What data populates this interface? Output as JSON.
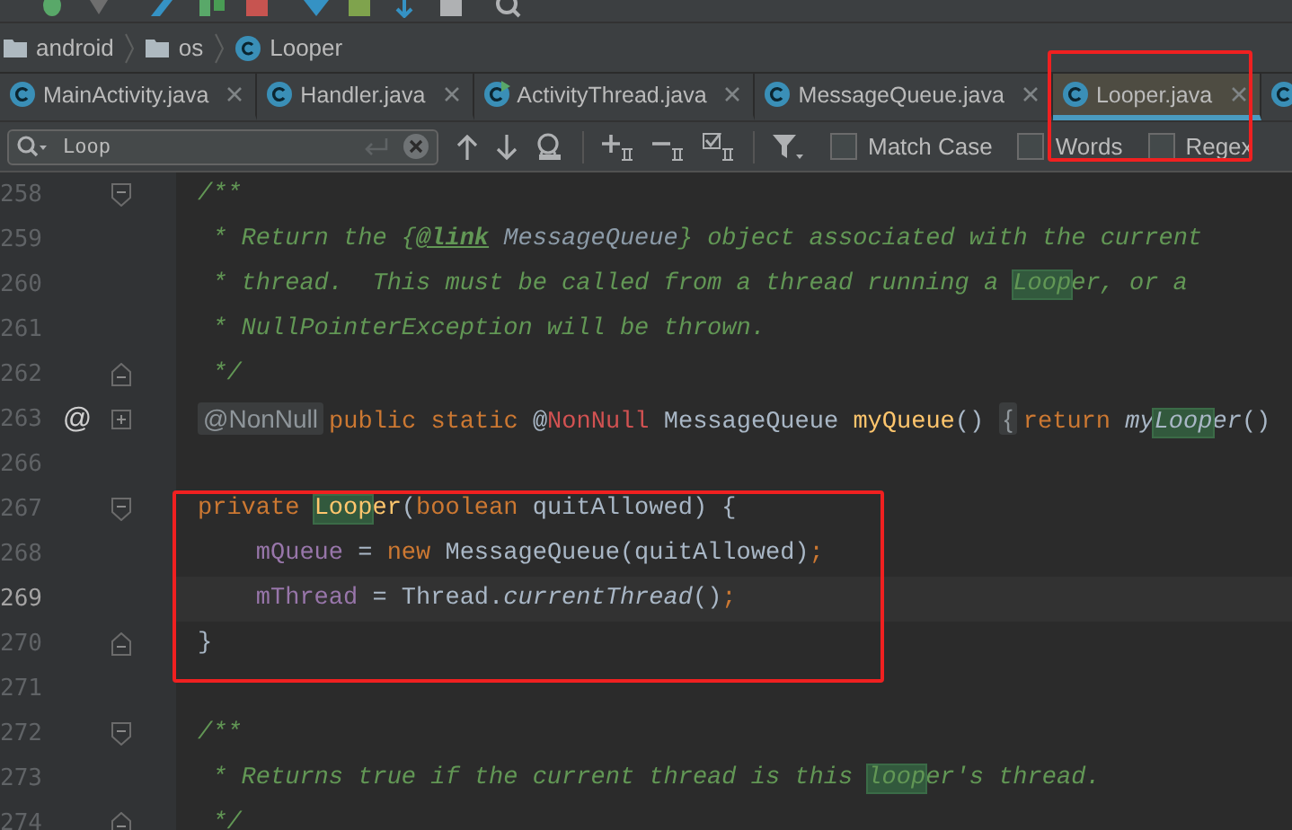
{
  "breadcrumb": [
    {
      "label": "android",
      "kind": "folder"
    },
    {
      "label": "os",
      "kind": "folder"
    },
    {
      "label": "Looper",
      "kind": "class"
    }
  ],
  "tabs": [
    {
      "label": "MainActivity.java",
      "selected": false,
      "kind": "class"
    },
    {
      "label": "Handler.java",
      "selected": false,
      "kind": "class"
    },
    {
      "label": "ActivityThread.java",
      "selected": false,
      "kind": "runnable"
    },
    {
      "label": "MessageQueue.java",
      "selected": false,
      "kind": "class"
    },
    {
      "label": "Looper.java",
      "selected": true,
      "kind": "class"
    },
    {
      "selected": false,
      "kind": "class"
    }
  ],
  "find_bar": {
    "query": "Loop",
    "options": [
      {
        "label": "Match Case",
        "checked": false
      },
      {
        "label": "Words",
        "checked": false
      },
      {
        "label": "Regex",
        "checked": false
      }
    ]
  },
  "lines": [
    {
      "number": "258",
      "current": false,
      "fold": {
        "kind": "start"
      },
      "segments": [
        {
          "text": "/**",
          "kind": "comment",
          "highlighted": false
        }
      ]
    },
    {
      "number": "259",
      "current": false,
      "segments": [
        {
          "text": " * Return the {",
          "kind": "comment",
          "highlighted": false
        },
        {
          "text": "@link",
          "kind": "comment-tag",
          "highlighted": false
        },
        {
          "text": " MessageQueue",
          "kind": "comment-ref",
          "highlighted": false
        },
        {
          "text": "} object associated with the current",
          "kind": "comment",
          "highlighted": false
        }
      ]
    },
    {
      "number": "260",
      "current": false,
      "segments": [
        {
          "text": " * thread.  This must be called from a thread running a ",
          "kind": "comment",
          "highlighted": false
        },
        {
          "text": "Loop",
          "kind": "comment",
          "highlighted": true
        },
        {
          "text": "er, or a",
          "kind": "comment",
          "highlighted": false
        }
      ]
    },
    {
      "number": "261",
      "current": false,
      "segments": [
        {
          "text": " * NullPointerException will be thrown.",
          "kind": "comment",
          "highlighted": false
        }
      ]
    },
    {
      "number": "262",
      "current": false,
      "fold": {
        "kind": "end"
      },
      "segments": [
        {
          "text": " */",
          "kind": "comment",
          "highlighted": false
        }
      ]
    },
    {
      "number": "263",
      "current": false,
      "fold": {
        "kind": "collapsed"
      },
      "marker": "@",
      "segments": [
        {
          "text": "@NonNull",
          "kind": "folded",
          "highlighted": false
        },
        {
          "text": "public static ",
          "kind": "keyword",
          "highlighted": false
        },
        {
          "text": "@",
          "kind": "plain",
          "highlighted": false
        },
        {
          "text": "NonNull",
          "kind": "annotation",
          "highlighted": false
        },
        {
          "text": " MessageQueue ",
          "kind": "plain",
          "highlighted": false
        },
        {
          "text": "myQueue",
          "kind": "method",
          "highlighted": false
        },
        {
          "text": "() ",
          "kind": "plain",
          "highlighted": false
        },
        {
          "text": "{",
          "kind": "folded",
          "highlighted": false
        },
        {
          "text": "return ",
          "kind": "keyword",
          "highlighted": false
        },
        {
          "text": "my",
          "kind": "static-call",
          "highlighted": false
        },
        {
          "text": "Loop",
          "kind": "static-call",
          "highlighted": true
        },
        {
          "text": "er",
          "kind": "static-call",
          "highlighted": false
        },
        {
          "text": "()",
          "kind": "plain",
          "highlighted": false
        }
      ]
    },
    {
      "number": "266",
      "current": false
    },
    {
      "number": "267",
      "current": false,
      "fold": {
        "kind": "start"
      },
      "segments": [
        {
          "text": "private ",
          "kind": "keyword",
          "highlighted": false
        },
        {
          "text": "Loop",
          "kind": "method",
          "highlighted": true
        },
        {
          "text": "er",
          "kind": "method",
          "highlighted": false
        },
        {
          "text": "(",
          "kind": "plain",
          "highlighted": false
        },
        {
          "text": "boolean ",
          "kind": "keyword",
          "highlighted": false
        },
        {
          "text": "quitAllowed) {",
          "kind": "plain",
          "highlighted": false
        }
      ]
    },
    {
      "number": "268",
      "current": false,
      "segments": [
        {
          "text": "    mQueue",
          "kind": "field",
          "highlighted": false
        },
        {
          "text": " = ",
          "kind": "plain",
          "highlighted": false
        },
        {
          "text": "new ",
          "kind": "keyword",
          "highlighted": false
        },
        {
          "text": "MessageQueue(quitAllowed)",
          "kind": "plain",
          "highlighted": false
        },
        {
          "text": ";",
          "kind": "keyword",
          "highlighted": false
        }
      ]
    },
    {
      "number": "269",
      "current": true,
      "segments": [
        {
          "text": "    mThread",
          "kind": "field",
          "highlighted": false
        },
        {
          "text": " = Thread.",
          "kind": "plain",
          "highlighted": false
        },
        {
          "text": "currentThread",
          "kind": "static-call",
          "highlighted": false
        },
        {
          "text": "()",
          "kind": "plain",
          "highlighted": false
        },
        {
          "text": ";",
          "kind": "keyword",
          "highlighted": false
        }
      ]
    },
    {
      "number": "270",
      "current": false,
      "fold": {
        "kind": "end"
      },
      "segments": [
        {
          "text": "}",
          "kind": "plain",
          "highlighted": false
        }
      ]
    },
    {
      "number": "271",
      "current": false
    },
    {
      "number": "272",
      "current": false,
      "fold": {
        "kind": "start"
      },
      "segments": [
        {
          "text": "/**",
          "kind": "comment",
          "highlighted": false
        }
      ]
    },
    {
      "number": "273",
      "current": false,
      "segments": [
        {
          "text": " * Returns true if the current thread is this ",
          "kind": "comment",
          "highlighted": false
        },
        {
          "text": "loop",
          "kind": "comment",
          "highlighted": true
        },
        {
          "text": "er's thread.",
          "kind": "comment",
          "highlighted": false
        }
      ]
    },
    {
      "number": "274",
      "current": false,
      "fold": {
        "kind": "end"
      },
      "segments": [
        {
          "text": " */",
          "kind": "comment",
          "highlighted": false
        }
      ]
    }
  ]
}
